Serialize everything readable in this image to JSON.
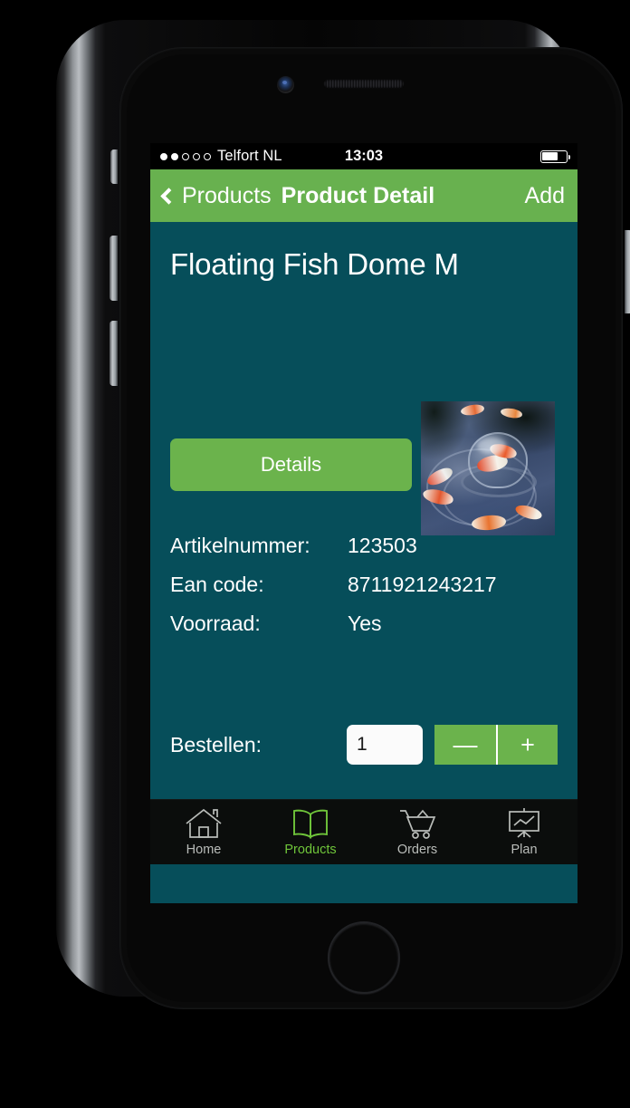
{
  "status_bar": {
    "signal_dots_filled": 2,
    "signal_dots_total": 5,
    "carrier": "Telfort NL",
    "time": "13:03",
    "battery_percent": 65
  },
  "nav_bar": {
    "back_label": "Products",
    "back_icon": "chevron-left-icon",
    "title": "Product Detail",
    "action_label": "Add",
    "background_color": "#68b14f"
  },
  "product": {
    "title": "Floating Fish Dome M",
    "details_button_label": "Details",
    "photo_alt": "koi-pond-floating-dome-photo",
    "fields": [
      {
        "label": "Artikelnummer:",
        "value": "123503"
      },
      {
        "label": "Ean code:",
        "value": "8711921243217"
      },
      {
        "label": "Voorraad:",
        "value": "Yes"
      }
    ]
  },
  "order": {
    "label": "Bestellen:",
    "quantity_value": "1",
    "quantity_placeholder": "1",
    "decrement_label": "—",
    "increment_label": "+"
  },
  "tab_bar": {
    "active_color": "#6fc53a",
    "inactive_color": "#b9bcb9",
    "tabs": [
      {
        "label": "Home",
        "icon": "home-icon",
        "active": false
      },
      {
        "label": "Products",
        "icon": "book-icon",
        "active": true
      },
      {
        "label": "Orders",
        "icon": "shopping-cart-icon",
        "active": false
      },
      {
        "label": "Plan",
        "icon": "presentation-chart-icon",
        "active": false
      }
    ]
  },
  "theme": {
    "screen_background": "#064e5a",
    "accent_green": "#6bb34c",
    "tab_bar_background": "#0b0d0c"
  }
}
